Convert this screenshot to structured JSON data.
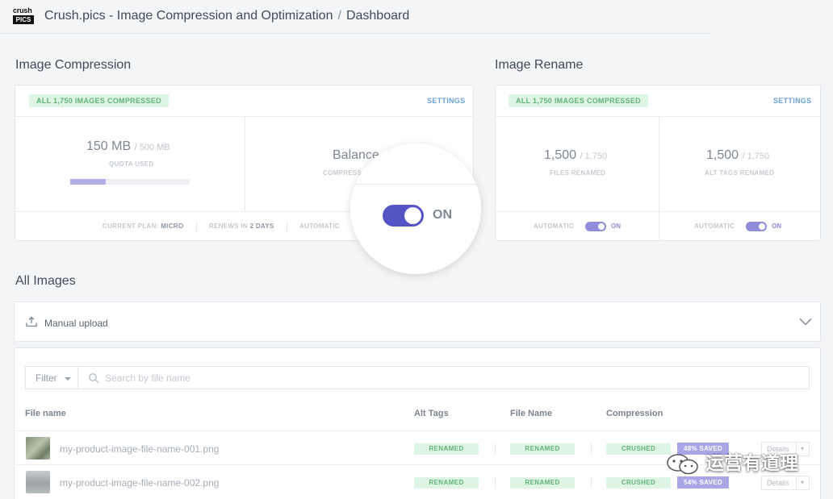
{
  "header": {
    "logo_top": "crush",
    "logo_bottom": "PICS",
    "app_title": "Crush.pics - Image Compression and Optimization",
    "separator": "/",
    "page": "Dashboard"
  },
  "compression": {
    "title": "Image Compression",
    "badge": "ALL 1,750 IMAGES COMPRESSED",
    "settings": "SETTINGS",
    "quota_value": "150 MB",
    "quota_total": "/ 500 MB",
    "quota_label": "QUOTA USED",
    "quota_fraction": 0.3,
    "mode_value": "Balance",
    "mode_label": "COMPRESS",
    "plan_label": "CURRENT PLAN:",
    "plan_value": "MICRO",
    "renew_label": "RENEWS IN",
    "renew_value": "2 DAYS",
    "automatic_label": "AUTOMATIC"
  },
  "magnifier": {
    "toggle_state": "ON"
  },
  "rename": {
    "title": "Image Rename",
    "badge": "ALL 1,750 IMAGES COMPRESSED",
    "settings": "SETTINGS",
    "files_value": "1,500",
    "files_total": "/ 1,750",
    "files_label": "FILES RENAMED",
    "alt_value": "1,500",
    "alt_total": "/ 1,750",
    "alt_label": "ALT TAGS RENAMED",
    "automatic_label": "AUTOMATIC",
    "on_label": "ON"
  },
  "all_images": {
    "title": "All Images",
    "upload_label": "Manual upload",
    "filter_label": "Filter",
    "search_placeholder": "Search by file name",
    "columns": [
      "File name",
      "Alt Tags",
      "File Name",
      "Compression"
    ],
    "rows": [
      {
        "file": "my-product-image-file-name-001.png",
        "alt": "RENAMED",
        "name": "RENAMED",
        "compression": "CRUSHED",
        "saved": "48% SAVED",
        "action": "Details"
      },
      {
        "file": "my-product-image-file-name-002.png",
        "alt": "RENAMED",
        "name": "RENAMED",
        "compression": "CRUSHED",
        "saved": "54% SAVED",
        "action": "Details"
      }
    ]
  },
  "watermark": {
    "text": "运营有道理"
  },
  "colors": {
    "accent": "#5554c6",
    "accent_light": "#a8a6e6",
    "success_bg": "#dff5e4",
    "success_text": "#62b27a",
    "link": "#6a9fd8"
  }
}
